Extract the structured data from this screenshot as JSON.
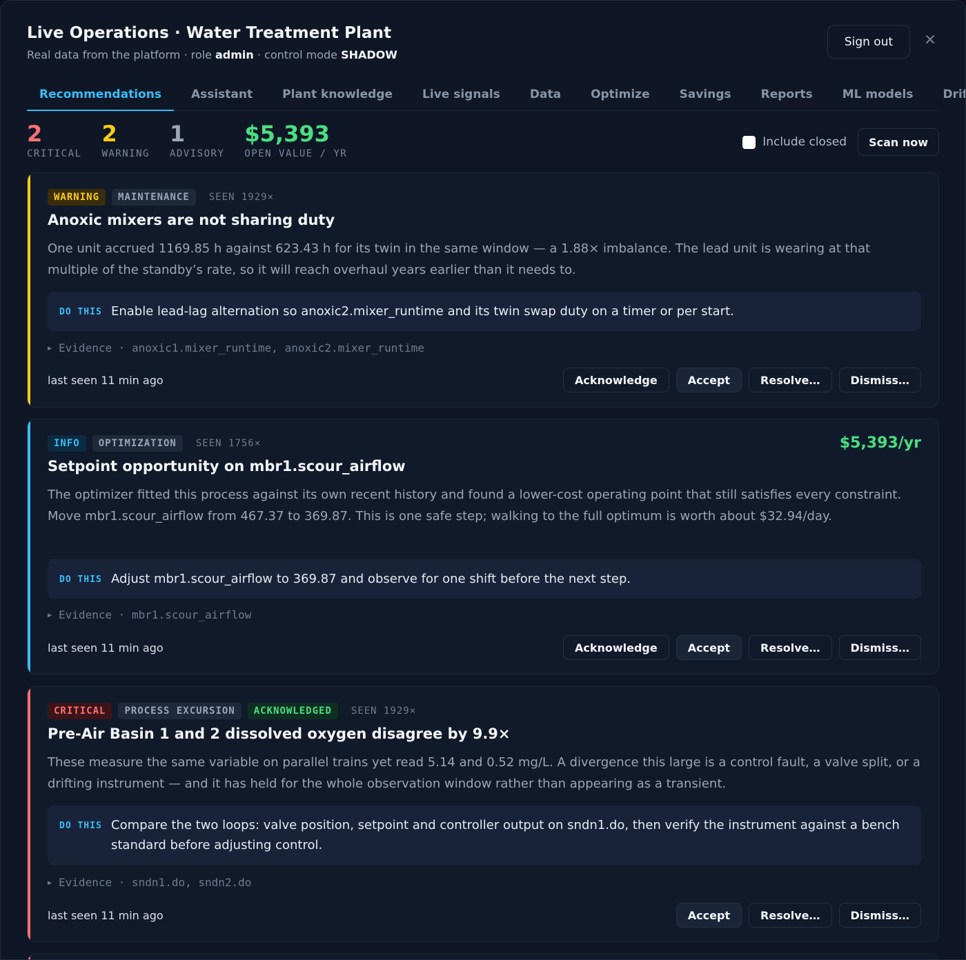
{
  "header": {
    "title": "Live Operations · Water Treatment Plant",
    "subtitle_prefix": "Real data from the platform · role ",
    "role": "admin",
    "subtitle_mid": " · control mode ",
    "mode": "SHADOW",
    "signout_label": "Sign out",
    "close_icon": "×"
  },
  "tabs": [
    "Recommendations",
    "Assistant",
    "Plant knowledge",
    "Live signals",
    "Data",
    "Optimize",
    "Savings",
    "Reports",
    "ML models",
    "Drift"
  ],
  "stats": {
    "critical": {
      "value": "2",
      "label": "CRITICAL",
      "color": "#f87171"
    },
    "warning": {
      "value": "2",
      "label": "WARNING",
      "color": "#facc15"
    },
    "advisory": {
      "value": "1",
      "label": "ADVISORY",
      "color": "#9aa5b8"
    },
    "open_value": {
      "value": "$5,393",
      "label": "OPEN VALUE / YR",
      "color": "#4ade80"
    }
  },
  "controls": {
    "include_closed_label": "Include closed",
    "scan_label": "Scan now"
  },
  "do_label": "DO THIS",
  "evidence_label": "Evidence",
  "evidence_sep": "·",
  "cards": [
    {
      "severity": "WARNING",
      "category": "MAINTENANCE",
      "seen": "SEEN 1929×",
      "title": "Anoxic mixers are not sharing duty",
      "description": "One unit accrued 1169.85 h against 623.43 h for its twin in the same window — a 1.88× imbalance. The lead unit is wearing at that multiple of the standby’s rate, so it will reach overhaul years earlier than it needs to.",
      "do_this": "Enable lead-lag alternation so anoxic2.mixer_runtime and its twin swap duty on a timer or per start.",
      "evidence": "anoxic1.mixer_runtime, anoxic2.mixer_runtime",
      "last_seen": "last seen 11 min ago",
      "actions": [
        "Acknowledge",
        "Accept",
        "Resolve…",
        "Dismiss…"
      ],
      "accent": "#facc15"
    },
    {
      "severity": "INFO",
      "category": "OPTIMIZATION",
      "seen": "SEEN 1756×",
      "value": "$5,393/yr",
      "title": "Setpoint opportunity on mbr1.scour_airflow",
      "description": "The optimizer fitted this process against its own recent history and found a lower-cost operating point that still satisfies every constraint. Move mbr1.scour_airflow from 467.37 to 369.87. This is one safe step; walking to the full optimum is worth about $32.94/day.",
      "do_this": "Adjust mbr1.scour_airflow to 369.87 and observe for one shift before the next step.",
      "evidence": "mbr1.scour_airflow",
      "last_seen": "last seen 11 min ago",
      "actions": [
        "Acknowledge",
        "Accept",
        "Resolve…",
        "Dismiss…"
      ],
      "accent": "#38bdf8"
    },
    {
      "severity": "CRITICAL",
      "category": "PROCESS EXCURSION",
      "status": "ACKNOWLEDGED",
      "seen": "SEEN 1929×",
      "title": "Pre-Air Basin 1 and 2 dissolved oxygen disagree by 9.9×",
      "description": "These measure the same variable on parallel trains yet read 5.14 and 0.52 mg/L. A divergence this large is a control fault, a valve split, or a drifting instrument — and it has held for the whole observation window rather than appearing as a transient.",
      "do_this": "Compare the two loops: valve position, setpoint and controller output on sndn1.do, then verify the instrument against a bench standard before adjusting control.",
      "evidence": "sndn1.do, sndn2.do",
      "last_seen": "last seen 11 min ago",
      "actions": [
        "Accept",
        "Resolve…",
        "Dismiss…"
      ],
      "accent": "#f87171"
    }
  ]
}
